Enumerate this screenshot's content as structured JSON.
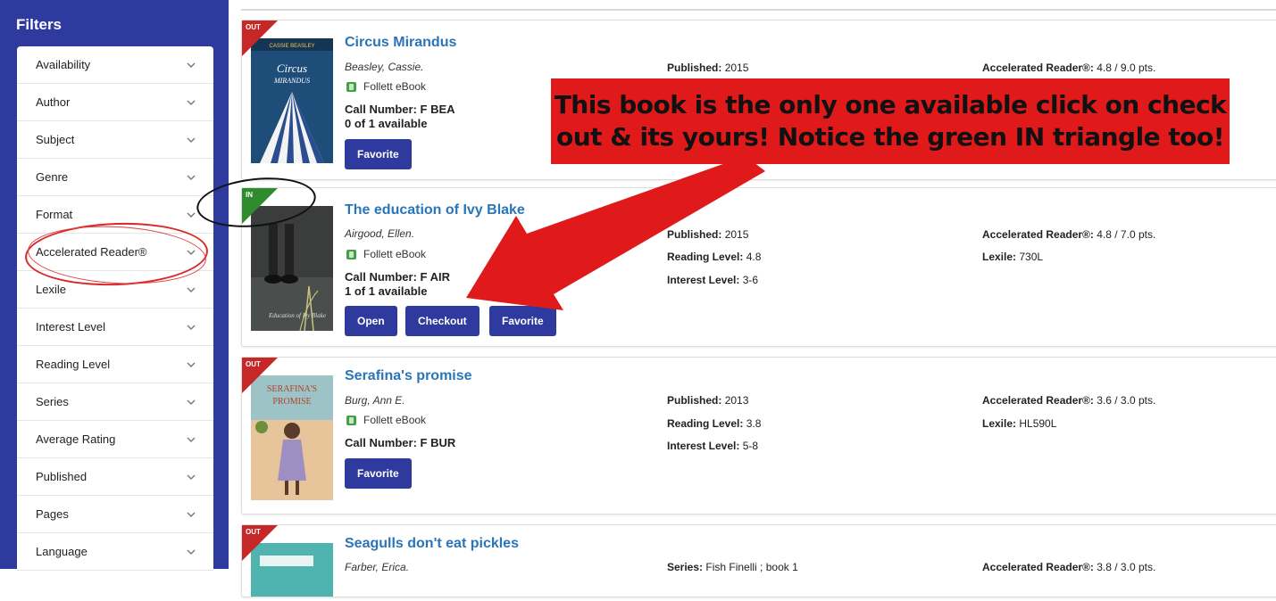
{
  "sidebar": {
    "title": "Filters",
    "items": [
      {
        "label": "Availability"
      },
      {
        "label": "Author"
      },
      {
        "label": "Subject"
      },
      {
        "label": "Genre"
      },
      {
        "label": "Format"
      },
      {
        "label": "Accelerated Reader®"
      },
      {
        "label": "Lexile"
      },
      {
        "label": "Interest Level"
      },
      {
        "label": "Reading Level"
      },
      {
        "label": "Series"
      },
      {
        "label": "Average Rating"
      },
      {
        "label": "Published"
      },
      {
        "label": "Pages"
      },
      {
        "label": "Language"
      }
    ]
  },
  "books": [
    {
      "status": "OUT",
      "title": "Circus Mirandus",
      "author": "Beasley, Cassie.",
      "format": "Follett eBook",
      "call_label": "Call Number:",
      "call_number": "F BEA",
      "availability": "0 of 1 available",
      "buttons": {
        "favorite": "Favorite"
      },
      "published_label": "Published:",
      "published": "2015",
      "ar_label": "Accelerated Reader®:",
      "ar": "4.8 / 9.0 pts."
    },
    {
      "status": "IN",
      "title": "The education of Ivy Blake",
      "author": "Airgood, Ellen.",
      "format": "Follett eBook",
      "call_label": "Call Number:",
      "call_number": "F AIR",
      "availability": "1 of 1 available",
      "buttons": {
        "open": "Open",
        "checkout": "Checkout",
        "favorite": "Favorite"
      },
      "published_label": "Published:",
      "published": "2015",
      "reading_label": "Reading Level:",
      "reading": "4.8",
      "interest_label": "Interest Level:",
      "interest": "3-6",
      "ar_label": "Accelerated Reader®:",
      "ar": "4.8 / 7.0 pts.",
      "lexile_label": "Lexile:",
      "lexile": "730L"
    },
    {
      "status": "OUT",
      "title": "Serafina's promise",
      "author": "Burg, Ann E.",
      "format": "Follett eBook",
      "call_label": "Call Number:",
      "call_number": "F BUR",
      "buttons": {
        "favorite": "Favorite"
      },
      "published_label": "Published:",
      "published": "2013",
      "reading_label": "Reading Level:",
      "reading": "3.8",
      "interest_label": "Interest Level:",
      "interest": "5-8",
      "ar_label": "Accelerated Reader®:",
      "ar": "3.6 / 3.0 pts.",
      "lexile_label": "Lexile:",
      "lexile": "HL590L"
    },
    {
      "status": "OUT",
      "title": "Seagulls don't eat pickles",
      "author": "Farber, Erica.",
      "series_label": "Series:",
      "series": "Fish Finelli ; book 1",
      "ar_label": "Accelerated Reader®:",
      "ar": "3.8 / 3.0 pts."
    }
  ],
  "annotation": {
    "line1": "This book is the only one available click on check",
    "line2": "out & its yours!  Notice the green IN triangle too!"
  },
  "colors": {
    "sidebar_bg": "#2e3a9e",
    "button_bg": "#2e3a9e",
    "title_link": "#2a74b8",
    "out_corner": "#c62828",
    "in_corner": "#2e8b2e",
    "banner": "#e01a1a"
  }
}
